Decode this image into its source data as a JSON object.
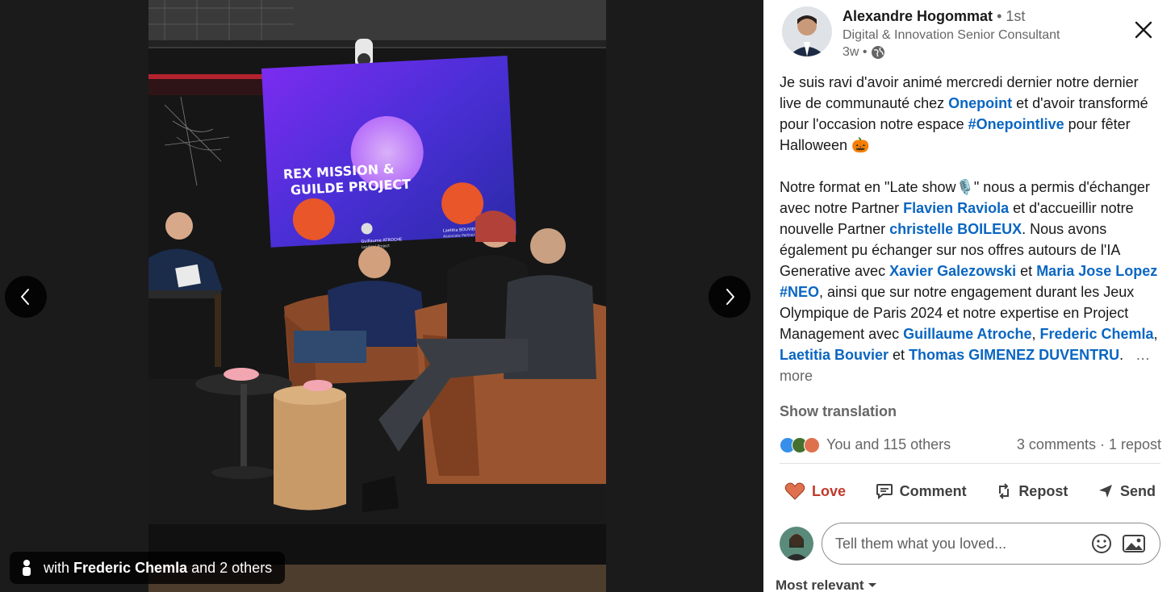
{
  "viewer": {
    "tag_prefix": "with",
    "tag_name": "Frederic Chemla",
    "tag_suffix": "and 2 others",
    "prev_icon": "chevron-left-icon",
    "next_icon": "chevron-right-icon",
    "photo_screen": {
      "line1": "REX MISSION &",
      "line2": "GUILDE PROJECT",
      "speaker_name": "Guillaume ATROCHE",
      "speaker_role": "Leader | Project",
      "speaker2_name": "Laetitia BOUVIER",
      "speaker2_role": "Associate Partner"
    }
  },
  "post": {
    "author_name": "Alexandre Hogommat",
    "author_degree": "• 1st",
    "author_title": "Digital & Innovation Senior Consultant",
    "time": "3w •",
    "visibility_icon": "globe-icon",
    "close_icon": "close-icon",
    "p1": {
      "t1": "Je suis ravi d'avoir animé mercredi dernier notre dernier live de communauté chez ",
      "l1": "Onepoint",
      "t2": " et d'avoir transformé pour l'occasion notre espace ",
      "l2": "#Onepointlive",
      "t3": " pour fêter Halloween 🎃"
    },
    "p2": {
      "t1": "Notre format en \"Late show🎙️\" nous a permis d'échanger avec notre Partner ",
      "l1": "Flavien Raviola",
      "t2": " et d'accueillir notre nouvelle Partner ",
      "l2": "christelle BOILEUX",
      "t3": ". Nous avons également pu échanger sur nos offres autours de l'IA Generative avec ",
      "l3": "Xavier Galezowski",
      "t4": " et ",
      "l4": "Maria Jose Lopez",
      "t5": " ",
      "l5": "#NEO",
      "t6": ", ainsi que sur notre engagement durant les Jeux Olympique de Paris 2024 et notre expertise en Project Management avec ",
      "l6": "Guillaume Atroche",
      "t7": ", ",
      "l7": "Frederic Chemla",
      "t8": ", ",
      "l8": "Laetitia Bouvier",
      "t9": " et ",
      "l9": "Thomas GIMENEZ DUVENTRU",
      "t10": ".",
      "more": "…more"
    },
    "show_translation": "Show translation",
    "reactions_text": "You and 115 others",
    "counts_text": "3 comments · 1 repost",
    "actions": {
      "love": "Love",
      "comment": "Comment",
      "repost": "Repost",
      "send": "Send"
    },
    "comment_placeholder": "Tell them what you loved...",
    "emoji_icon": "emoji-icon",
    "image_icon": "image-icon",
    "sort_label": "Most relevant"
  },
  "colors": {
    "link": "#0a66c2",
    "love": "#c0392b",
    "viewer_bg": "#1b1b1b"
  }
}
